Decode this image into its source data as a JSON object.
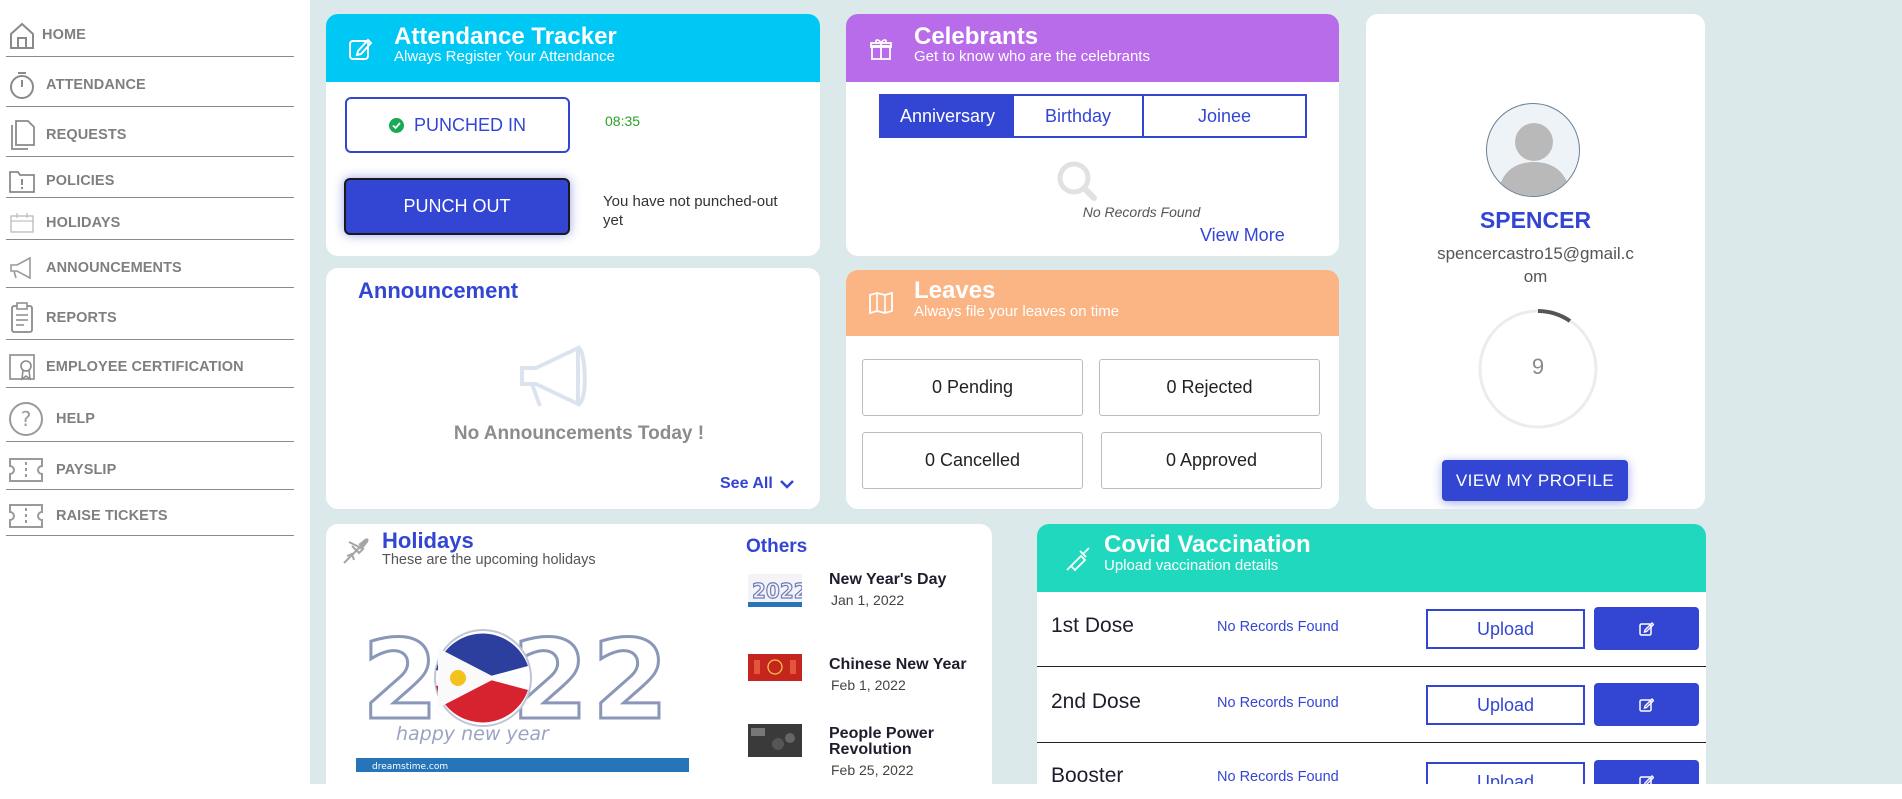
{
  "sidebar": {
    "items": [
      {
        "label": "HOME",
        "icon": "home-icon"
      },
      {
        "label": "ATTENDANCE",
        "icon": "stopwatch-icon"
      },
      {
        "label": "REQUESTS",
        "icon": "documents-icon"
      },
      {
        "label": "POLICIES",
        "icon": "policy-icon"
      },
      {
        "label": "HOLIDAYS",
        "icon": "calendar-icon"
      },
      {
        "label": "ANNOUNCEMENTS",
        "icon": "megaphone-icon"
      },
      {
        "label": "REPORTS",
        "icon": "clipboard-icon"
      },
      {
        "label": "EMPLOYEE CERTIFICATION",
        "icon": "certificate-icon"
      },
      {
        "label": "HELP",
        "icon": "help-icon"
      },
      {
        "label": "PAYSLIP",
        "icon": "ticket-icon"
      },
      {
        "label": "RAISE TICKETS",
        "icon": "ticket-icon"
      }
    ]
  },
  "attendance": {
    "title": "Attendance Tracker",
    "subtitle": "Always Register Your Attendance",
    "punched_in_label": "PUNCHED IN",
    "punch_time": "08:35",
    "punch_out_label": "PUNCH OUT",
    "punch_out_status": "You have not punched-out yet",
    "header_color": "#00c8f5"
  },
  "celebrants": {
    "title": "Celebrants",
    "subtitle": "Get to know who are the celebrants",
    "tabs": [
      "Anniversary",
      "Birthday",
      "Joinee"
    ],
    "active_tab": "Anniversary",
    "empty_text": "No Records Found",
    "view_more": "View More",
    "header_color": "#b96cea"
  },
  "announcement": {
    "title": "Announcement",
    "empty_text": "No Announcements Today !",
    "see_all": "See All"
  },
  "leaves": {
    "title": "Leaves",
    "subtitle": "Always file your leaves on time",
    "pending": "0 Pending",
    "rejected": "0 Rejected",
    "cancelled": "0 Cancelled",
    "approved": "0 Approved",
    "header_color": "#fbb484"
  },
  "profile": {
    "name": "SPENCER",
    "email_line1": "spencercastro15@gmail.c",
    "email_line2": "om",
    "progress_value": "9",
    "view_profile": "VIEW MY PROFILE"
  },
  "holidays": {
    "title": "Holidays",
    "subtitle": "These are the upcoming holidays",
    "others_label": "Others",
    "image_caption": "dreamstime.com",
    "banner_text": "happy new year",
    "items": [
      {
        "name": "New Year's Day",
        "date": "Jan 1, 2022"
      },
      {
        "name": "Chinese New Year",
        "date": "Feb 1, 2022"
      },
      {
        "name_line1": "People Power",
        "name_line2": "Revolution",
        "date": "Feb 25, 2022"
      }
    ]
  },
  "covid": {
    "title": "Covid Vaccination",
    "subtitle": "Upload vaccination details",
    "header_color": "#1fd8bd",
    "rows": [
      {
        "label": "1st Dose",
        "status": "No Records Found",
        "upload": "Upload"
      },
      {
        "label": "2nd Dose",
        "status": "No Records Found",
        "upload": "Upload"
      },
      {
        "label": "Booster",
        "status": "No Records Found",
        "upload": "Upload"
      }
    ]
  }
}
